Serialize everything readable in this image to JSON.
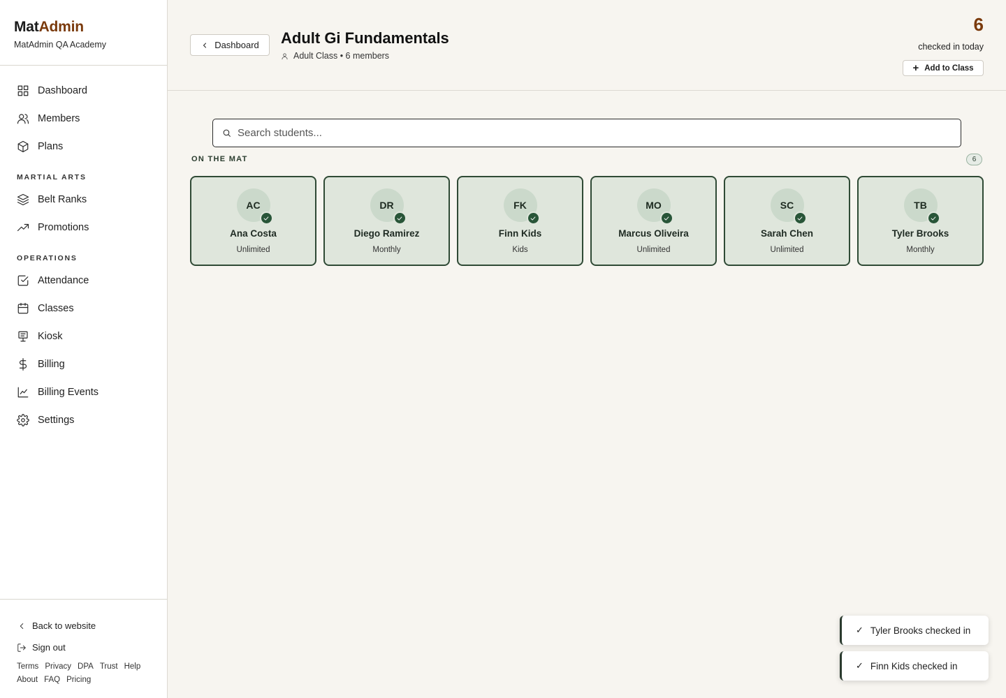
{
  "brand": {
    "name_part1": "Mat",
    "name_part2": "Admin",
    "academy": "MatAdmin QA Academy"
  },
  "nav": {
    "main": [
      {
        "label": "Dashboard",
        "icon": "dashboard-icon"
      },
      {
        "label": "Members",
        "icon": "members-icon"
      },
      {
        "label": "Plans",
        "icon": "box-icon"
      }
    ],
    "martial_arts_title": "MARTIAL ARTS",
    "martial_arts": [
      {
        "label": "Belt Ranks",
        "icon": "layers-icon"
      },
      {
        "label": "Promotions",
        "icon": "trend-up-icon"
      }
    ],
    "operations_title": "OPERATIONS",
    "operations": [
      {
        "label": "Attendance",
        "icon": "check-square-icon"
      },
      {
        "label": "Classes",
        "icon": "calendar-icon"
      },
      {
        "label": "Kiosk",
        "icon": "kiosk-icon"
      },
      {
        "label": "Billing",
        "icon": "dollar-icon"
      },
      {
        "label": "Billing Events",
        "icon": "chart-icon"
      },
      {
        "label": "Settings",
        "icon": "gear-icon"
      }
    ]
  },
  "sidebar_bottom": {
    "back_to_website": "Back to website",
    "sign_out": "Sign out",
    "footer_links": [
      "Terms",
      "Privacy",
      "DPA",
      "Trust",
      "Help",
      "About",
      "FAQ",
      "Pricing"
    ]
  },
  "header": {
    "back_label": "Dashboard",
    "class_title": "Adult Gi Fundamentals",
    "class_meta": "Adult Class • 6 members",
    "checked_in_count": "6",
    "checked_in_label": "checked in today",
    "add_label": "Add to Class"
  },
  "search": {
    "placeholder": "Search students..."
  },
  "roster": {
    "section_label": "ON THE MAT",
    "count": "6",
    "students": [
      {
        "initials": "AC",
        "name": "Ana Costa",
        "plan": "Unlimited"
      },
      {
        "initials": "DR",
        "name": "Diego Ramirez",
        "plan": "Monthly"
      },
      {
        "initials": "FK",
        "name": "Finn Kids",
        "plan": "Kids"
      },
      {
        "initials": "MO",
        "name": "Marcus Oliveira",
        "plan": "Unlimited"
      },
      {
        "initials": "SC",
        "name": "Sarah Chen",
        "plan": "Unlimited"
      },
      {
        "initials": "TB",
        "name": "Tyler Brooks",
        "plan": "Monthly"
      }
    ]
  },
  "toasts": [
    {
      "text": "Tyler Brooks checked in"
    },
    {
      "text": "Finn Kids checked in"
    }
  ],
  "colors": {
    "brand_accent": "#7a3a0c",
    "card_border": "#2f4a35",
    "card_bg": "#dfe6dc",
    "check_bg": "#285538"
  }
}
